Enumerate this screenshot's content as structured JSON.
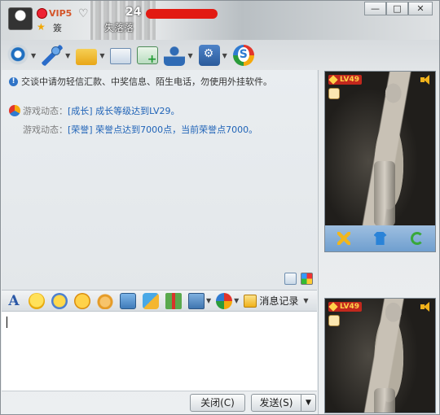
{
  "window": {
    "title_level": "24",
    "nickname": "失落落",
    "vip_label": "VIP5",
    "status_text": "簽",
    "controls": [
      "—",
      "□",
      "✕"
    ]
  },
  "toolbar": {
    "items": [
      {
        "name": "video-call",
        "has_menu": true
      },
      {
        "name": "voice-call",
        "has_menu": true
      },
      {
        "name": "send-file",
        "has_menu": true
      },
      {
        "name": "send-mail",
        "has_menu": false
      },
      {
        "name": "create-group",
        "has_menu": false
      },
      {
        "name": "user-info",
        "has_menu": true
      },
      {
        "name": "app-settings",
        "has_menu": true
      },
      {
        "name": "soso-app",
        "has_menu": false
      }
    ]
  },
  "chat": {
    "notice": "交谈中请勿轻信汇款、中奖信息、陌生电话，勿使用外挂软件。",
    "messages": [
      {
        "label": "游戏动态：",
        "text": "[成长] 成长等级达到LV29。"
      },
      {
        "label": "游戏动态：",
        "text": "[荣誉] 荣誉点达到7000点，当前荣誉点7000。"
      }
    ]
  },
  "format_bar": {
    "history_label": "消息记录"
  },
  "input": {
    "value": ""
  },
  "buttons": {
    "close": "关闭(C)",
    "send": "发送(S)",
    "send_menu": "▼"
  },
  "show_panels": [
    {
      "level": "LV49"
    },
    {
      "level": "LV49"
    }
  ],
  "colors": {
    "link_blue": "#1f63b7",
    "badge_red": "#c2281d",
    "titlebar_mark": "#e21a12"
  }
}
